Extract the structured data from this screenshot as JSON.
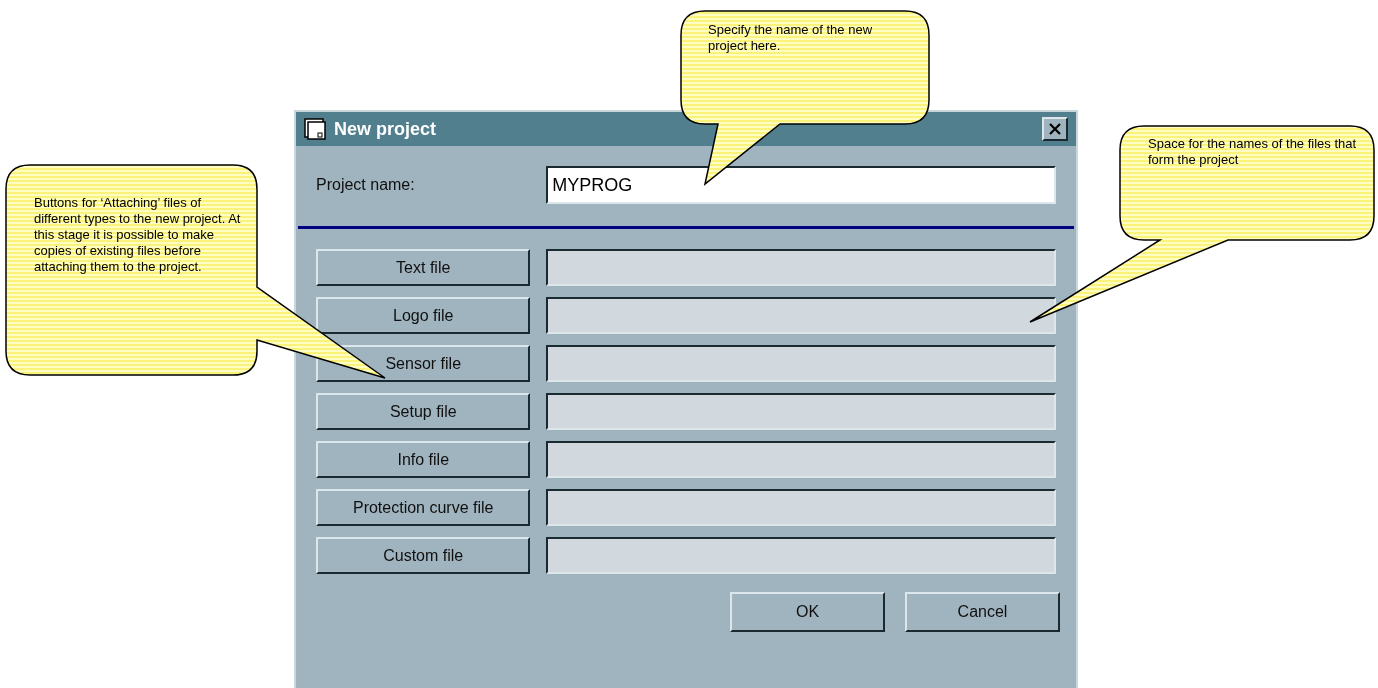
{
  "callouts": [
    {
      "text": "Specify the name of the new project here."
    },
    {
      "text": "Buttons for ‘Attaching’ files of different types to the new project. At this stage it is possible to make copies of existing files before attaching them to the project."
    },
    {
      "text": "Space for the names of the files that form the project"
    }
  ],
  "dialog": {
    "title": "New project",
    "project_name": {
      "label": "Project name:",
      "value": "MYPROG"
    },
    "file_rows": [
      {
        "button": "Text file"
      },
      {
        "button": "Logo file"
      },
      {
        "button": "Sensor file"
      },
      {
        "button": "Setup file"
      },
      {
        "button": "Info file"
      },
      {
        "button": "Protection curve file"
      },
      {
        "button": "Custom file"
      }
    ],
    "buttons": [
      "OK",
      "Cancel"
    ]
  }
}
